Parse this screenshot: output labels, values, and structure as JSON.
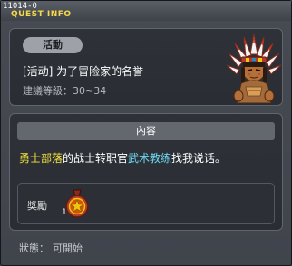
{
  "window": {
    "quest_id": "11014-0",
    "title": "QUEST INFO"
  },
  "quest": {
    "category": "活動",
    "name": "[活动] 为了冒险家的名誉",
    "level_label": "建議等級：",
    "level_range": "30~34",
    "portrait_icon": "native-chief-portrait-icon"
  },
  "content": {
    "header": "內容",
    "dialog": {
      "part1": "勇士部落",
      "part2": "的战士转职官",
      "part3": "武术教练",
      "part4": "找我说话。"
    }
  },
  "reward": {
    "label": "獎勵",
    "item_icon": "medal-item-icon",
    "item_count": "1"
  },
  "status": {
    "label": "狀態：",
    "value": "可開始"
  },
  "colors": {
    "title": "#f5d94a",
    "highlight_location": "#f0e23c",
    "highlight_npc": "#6ed8f0"
  }
}
